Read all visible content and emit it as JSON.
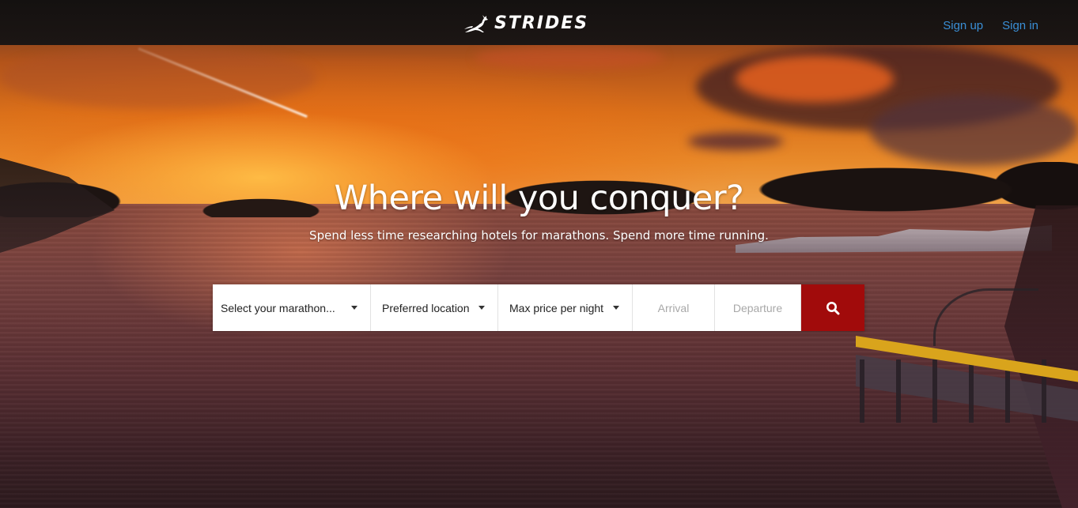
{
  "brand": {
    "name": "STRIDES",
    "logo_icon": "gazelle-leaping-icon"
  },
  "nav": {
    "links": [
      {
        "label": "Sign up"
      },
      {
        "label": "Sign in"
      }
    ],
    "link_color": "#3a8fd6"
  },
  "hero": {
    "title": "Where will you conquer?",
    "subtitle": "Spend less time researching hotels for marathons. Spend more time running.",
    "background": "sunset-river-photo"
  },
  "search": {
    "marathon_select": {
      "value": "Select your marathon..."
    },
    "location_select": {
      "value": "Preferred location"
    },
    "price_select": {
      "value": "Max price per night"
    },
    "arrival": {
      "placeholder": "Arrival",
      "value": ""
    },
    "departure": {
      "placeholder": "Departure",
      "value": ""
    },
    "submit_icon": "search-icon",
    "button_color": "#a10b0b"
  }
}
